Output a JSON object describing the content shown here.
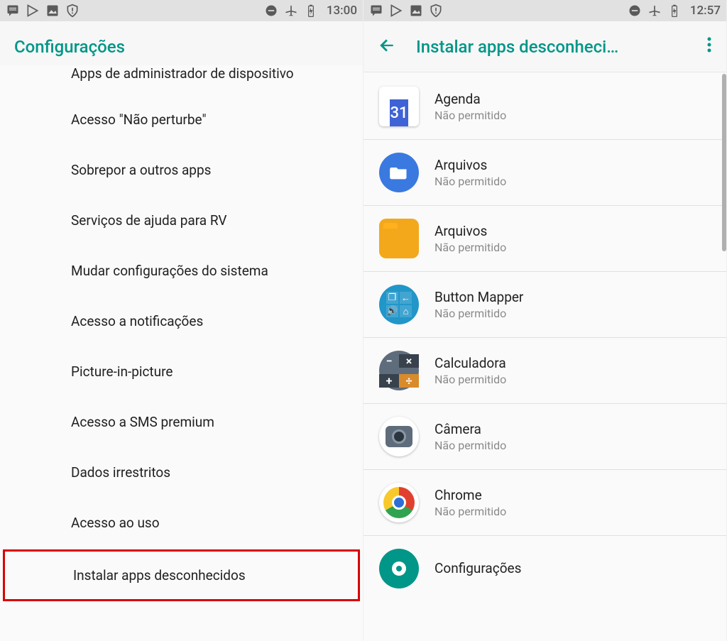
{
  "left": {
    "status": {
      "time": "13:00"
    },
    "header": {
      "title": "Configurações"
    },
    "items": [
      "Apps de administrador de dispositivo",
      "Acesso \"Não perturbe\"",
      "Sobrepor a outros apps",
      "Serviços de ajuda para RV",
      "Mudar configurações do sistema",
      "Acesso a notificações",
      "Picture-in-picture",
      "Acesso a SMS premium",
      "Dados irrestritos",
      "Acesso ao uso",
      "Instalar apps desconhecidos"
    ]
  },
  "right": {
    "status": {
      "time": "12:57"
    },
    "header": {
      "title": "Instalar apps desconheci…"
    },
    "apps": [
      {
        "name": "Agenda",
        "sub": "Não permitido",
        "cal_day": "31"
      },
      {
        "name": "Arquivos",
        "sub": "Não permitido"
      },
      {
        "name": "Arquivos",
        "sub": "Não permitido"
      },
      {
        "name": "Button Mapper",
        "sub": "Não permitido"
      },
      {
        "name": "Calculadora",
        "sub": "Não permitido"
      },
      {
        "name": "Câmera",
        "sub": "Não permitido"
      },
      {
        "name": "Chrome",
        "sub": "Não permitido"
      },
      {
        "name": "Configurações",
        "sub": ""
      }
    ]
  }
}
